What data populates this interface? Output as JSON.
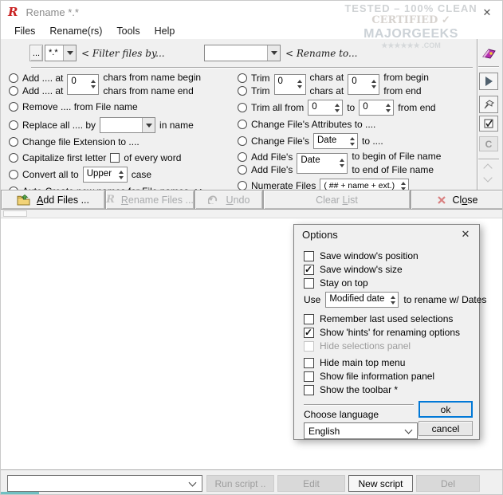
{
  "window": {
    "title": "Rename *.*"
  },
  "watermark": {
    "line1": "TESTED – 100% CLEAN",
    "line2": "CERTIFIED ✓",
    "line3": "MAJORGEEKS",
    "line4": "★★★★★★ .COM"
  },
  "menu": {
    "items": [
      "Files",
      "Rename(rs)",
      "Tools",
      "Help"
    ]
  },
  "filter_bar": {
    "browse": "...",
    "filter_value": "*.*",
    "filter_hint": "< Filter files by...",
    "rename_value": "",
    "rename_hint": "< Rename to..."
  },
  "left_options": {
    "add_begin_label": "Add .... at",
    "add_end_label": "Add .... at",
    "add_spin_value": "0",
    "add_begin_suffix": "chars from name begin",
    "add_end_suffix": "chars from name end",
    "remove": "Remove .... from File name",
    "replace_label": "Replace all .... by",
    "replace_value": "",
    "replace_suffix": "in name",
    "change_ext": "Change file Extension to ....",
    "capitalize_label": "Capitalize first letter",
    "capitalize_suffix": "of every word",
    "convert_label": "Convert all to",
    "convert_value": "Upper",
    "convert_suffix": "case",
    "autocreate": "Auto-Create new names for File names <.>"
  },
  "right_options": {
    "trim1_label": "Trim",
    "trim2_label": "Trim",
    "trim_chars_value": "0",
    "chars_at1": "chars at",
    "chars_at2": "chars at",
    "trim_pos_value": "0",
    "from_begin": "from begin",
    "from_end": "from end",
    "trimall_label": "Trim all from",
    "trimall_from_value": "0",
    "trimall_to_label": "to",
    "trimall_to_value": "0",
    "trimall_suffix": "from end",
    "attributes": "Change File's Attributes to ....",
    "changedate_label": "Change File's",
    "changedate_value": "Date",
    "changedate_suffix": "to ....",
    "addfile1_label": "Add File's",
    "addfile2_label": "Add File's",
    "addfile_value": "Date",
    "addfile1_suffix": "to begin of File name",
    "addfile2_suffix": "to end of File name",
    "numerate_label": "Numerate Files",
    "numerate_value": "( ## + name + ext.)"
  },
  "side_toolbar": {
    "c_label": "C"
  },
  "action_bar": {
    "add_files": "_A_dd Files ...",
    "rename_files": "_R_ename Files ...",
    "undo": "_U_ndo",
    "clear_list": "Clear _L_ist",
    "close": "Cl_o_se"
  },
  "options_dialog": {
    "title": "Options",
    "cb_top": [
      {
        "label": "Save window's position",
        "checked": false,
        "disabled": false
      },
      {
        "label": "Save window's size",
        "checked": true,
        "disabled": false
      },
      {
        "label": "Stay on top",
        "checked": false,
        "disabled": false
      }
    ],
    "use_label": "Use",
    "use_value": "Modified date",
    "use_suffix": "to rename w/ Dates",
    "cb_mid": [
      {
        "label": "Remember last used selections",
        "checked": false,
        "disabled": false
      },
      {
        "label": "Show 'hints' for renaming options",
        "checked": true,
        "disabled": false
      },
      {
        "label": "Hide selections panel",
        "checked": false,
        "disabled": true
      },
      {
        "label": "Hide main top menu",
        "checked": false,
        "disabled": false
      },
      {
        "label": "Show file information panel",
        "checked": false,
        "disabled": false
      },
      {
        "label": "Show the toolbar *",
        "checked": false,
        "disabled": false
      }
    ],
    "language_label": "Choose language",
    "language_value": "English",
    "ok": "ok",
    "cancel": "cancel"
  },
  "script_bar": {
    "script_value": "",
    "run": "Run script ..",
    "edit": "Edit",
    "new": "New script",
    "del": "Del"
  },
  "icons": {
    "window_close": "✕",
    "dialog_close": "✕",
    "app_logo": "R",
    "rename_files_logo": "R",
    "help_book": "book",
    "play": "▶",
    "pin": "pushpin",
    "hints_checkbox": "✓",
    "add_files_folder": "folder",
    "undo_arrow": "↶",
    "close_x": "✕"
  }
}
